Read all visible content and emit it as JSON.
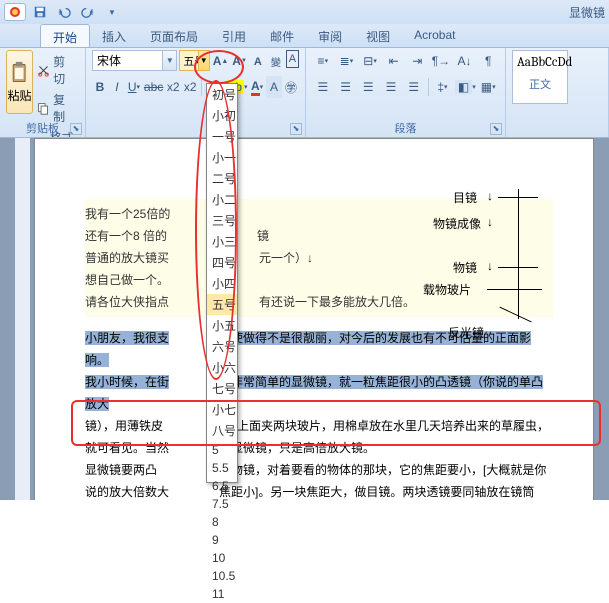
{
  "titlebar": {
    "doc_hint": "显微镜"
  },
  "tabs": {
    "t0": "开始",
    "t1": "插入",
    "t2": "页面布局",
    "t3": "引用",
    "t4": "邮件",
    "t5": "审阅",
    "t6": "视图",
    "t7": "Acrobat"
  },
  "clipboard": {
    "group": "剪贴板",
    "paste": "粘贴",
    "cut": "剪切",
    "copy": "复制",
    "painter": "格式刷"
  },
  "font": {
    "name": "宋体",
    "size": "五号",
    "options": [
      "初号",
      "小初",
      "一号",
      "小一",
      "二号",
      "小二",
      "三号",
      "小三",
      "四号",
      "小四",
      "五号",
      "小五",
      "六号",
      "小六",
      "七号",
      "小七",
      "八号",
      "5",
      "5.5",
      "6.5",
      "7.5",
      "8",
      "9",
      "10",
      "10.5",
      "11"
    ]
  },
  "paragraph": {
    "group": "段落"
  },
  "styles": {
    "sample": "AaBbCcDd",
    "name": "正文"
  },
  "doc": {
    "q1": "我有一个25倍的",
    "q1b": "",
    "q2": "还有一个8 倍的",
    "q2b": "镜",
    "q3": "普通的放大镜买",
    "q3b": "元一个）↓",
    "q4": "想自己做一个。",
    "q4b": "",
    "q5": "请各位大侠指点",
    "q5b": "有还说一下最多能放大几倍。",
    "d1": "目镜",
    "d2": "物镜成像",
    "d3": "物镜",
    "d4": "载物玻片",
    "d5": "反光镜",
    "p1a": "小朋友，我很支",
    "p1b": "即使做得不是很靓丽，对今后的发展也有不可估量的正面影响。",
    "p2a": "我小时候，在街",
    "p2b": "个非常简单的显微镜，就一粒焦距很小的凸透镜（你说的单凸放大",
    "p3a": "镜），用薄铁皮",
    "p3b": "住，上面夹两块玻片，用棉卓放在水里几天培养出来的草履虫，",
    "p4": "就可看见。当然",
    "p4b": "是显微镜，只是高倍放大镜。",
    "p5": "显微镜要两凸",
    "p5b": "个叫物镜，对着要看的物体的那块，它的焦距要小，[大概就是你",
    "p6": "说的放大倍数大",
    "p6b": "焦距小]。另一块焦距大，做目镜。两块透镜要同轴放在镜筒里，"
  }
}
